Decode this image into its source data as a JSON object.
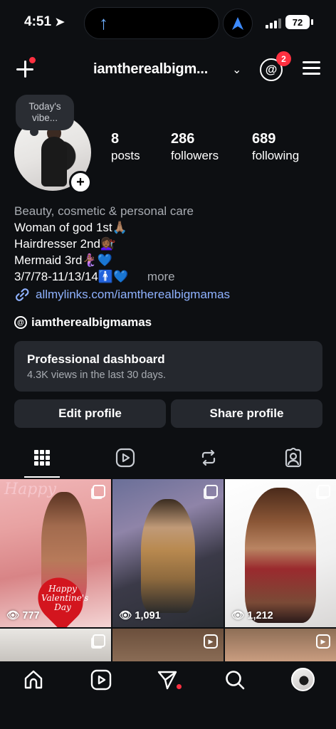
{
  "status_bar": {
    "time": "4:51",
    "battery": "72"
  },
  "header": {
    "username": "iamtherealbigm...",
    "threads_badge": "2"
  },
  "profile": {
    "note": "Today's vibe...",
    "stats": [
      {
        "value": "8",
        "label": "posts"
      },
      {
        "value": "286",
        "label": "followers"
      },
      {
        "value": "689",
        "label": "following"
      }
    ],
    "category": "Beauty, cosmetic & personal care",
    "bio_lines": [
      "Woman of god 1st🙏🏽",
      "Hairdresser 2nd💇🏾‍♀️",
      "Mermaid 3rd🧜🏾‍♀️💙",
      "3/7/78-11/13/14🚹💙"
    ],
    "more": "more",
    "link": "allmylinks.com/iamtherealbigmamas",
    "threads_handle": "iamtherealbigmamas"
  },
  "dashboard": {
    "title": "Professional dashboard",
    "subtitle": "4.3K views in the last 30 days."
  },
  "buttons": {
    "edit": "Edit profile",
    "share": "Share profile"
  },
  "grid": {
    "views": [
      "777",
      "1,091",
      "1,212"
    ],
    "overlay_top": "Happy",
    "overlay_heart": "Happy Valentine's Day"
  },
  "colors": {
    "accent_link": "#8fb2ff",
    "badge_red": "#ff3040",
    "card_bg": "#25282e"
  }
}
